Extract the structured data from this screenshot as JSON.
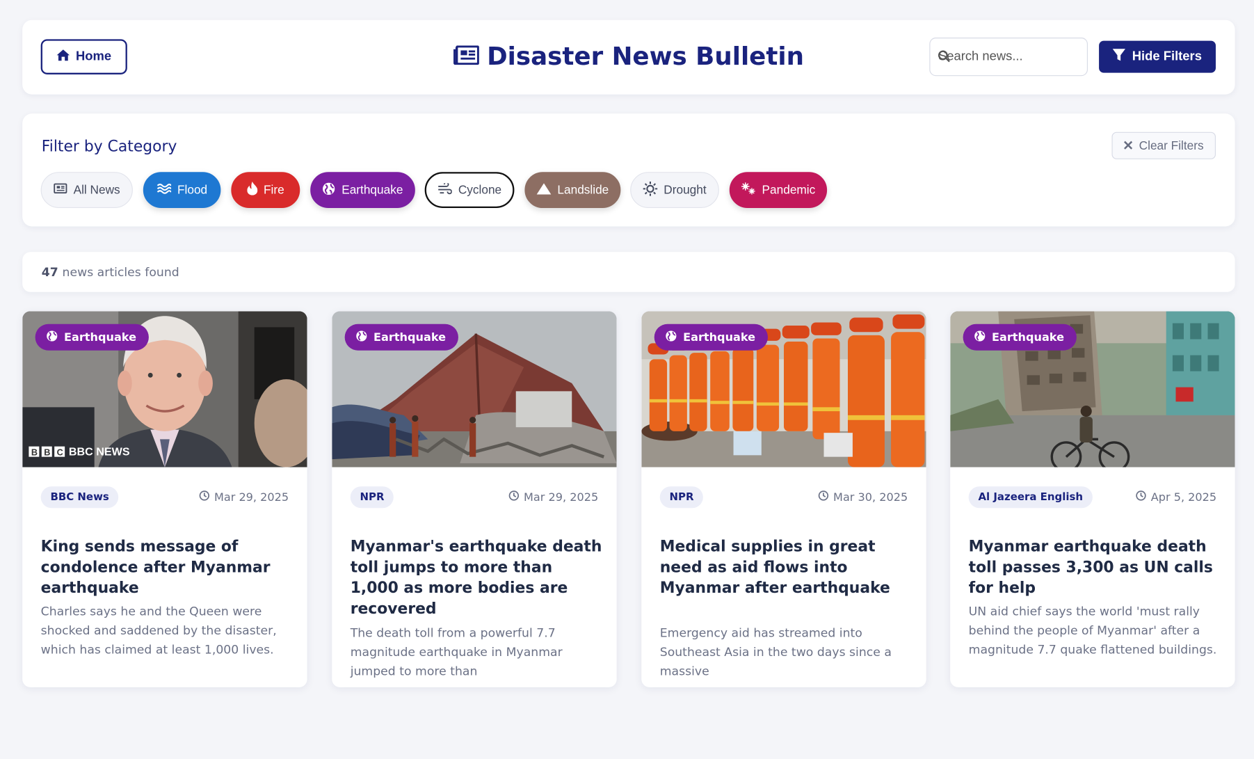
{
  "header": {
    "home_label": "Home",
    "title": "Disaster News Bulletin",
    "search_placeholder": "Search news...",
    "hide_filters_label": "Hide Filters"
  },
  "filters": {
    "title": "Filter by Category",
    "clear_label": "Clear Filters",
    "chips": [
      {
        "label": "All News",
        "icon": "newspaper-icon",
        "bg": "#f4f5f9",
        "color": "#444a5e",
        "border": "#e2e4ec"
      },
      {
        "label": "Flood",
        "icon": "water-waves-icon",
        "bg": "#1e78d2",
        "color": "#ffffff",
        "border": "#1e78d2"
      },
      {
        "label": "Fire",
        "icon": "flame-icon",
        "bg": "#d92b2b",
        "color": "#ffffff",
        "border": "#d92b2b"
      },
      {
        "label": "Earthquake",
        "icon": "globe-icon",
        "bg": "#7b1fa2",
        "color": "#ffffff",
        "border": "#7b1fa2"
      },
      {
        "label": "Cyclone",
        "icon": "wind-icon",
        "bg": "#ffffff",
        "color": "#444a5e",
        "border": "#111111"
      },
      {
        "label": "Landslide",
        "icon": "mountain-icon",
        "bg": "#8d6e63",
        "color": "#ffffff",
        "border": "#8d6e63"
      },
      {
        "label": "Drought",
        "icon": "sun-icon",
        "bg": "#f4f5f9",
        "color": "#444a5e",
        "border": "#e2e4ec"
      },
      {
        "label": "Pandemic",
        "icon": "virus-icon",
        "bg": "#c2185b",
        "color": "#ffffff",
        "border": "#c2185b"
      }
    ]
  },
  "results": {
    "count": "47",
    "label": "news articles found"
  },
  "cards": [
    {
      "category": "Earthquake",
      "source": "BBC News",
      "date": "Mar 29, 2025",
      "title": "King sends message of condolence after Myanmar earthquake",
      "summary": "Charles says he and the Queen were shocked and saddened by the disaster, which has claimed at least 1,000 lives.",
      "image_watermark": "BBC NEWS"
    },
    {
      "category": "Earthquake",
      "source": "NPR",
      "date": "Mar 29, 2025",
      "title": "Myanmar's earthquake death toll jumps to more than 1,000 as more bodies are recovered",
      "summary": "The death toll from a powerful 7.7 magnitude earthquake in Myanmar jumped to more than"
    },
    {
      "category": "Earthquake",
      "source": "NPR",
      "date": "Mar 30, 2025",
      "title": "Medical supplies in great need as aid flows into Myanmar after earthquake",
      "summary": "Emergency aid has streamed into Southeast Asia in the two days since a massive"
    },
    {
      "category": "Earthquake",
      "source": "Al Jazeera English",
      "date": "Apr 5, 2025",
      "title": "Myanmar earthquake death toll passes 3,300 as UN calls for help",
      "summary": "UN aid chief says the world 'must rally behind the people of Myanmar' after a magnitude 7.7 quake flattened buildings."
    }
  ],
  "colors": {
    "primary": "#1a237e",
    "earthquake_badge": "#7b1fa2",
    "page_bg": "#f4f5f9"
  }
}
